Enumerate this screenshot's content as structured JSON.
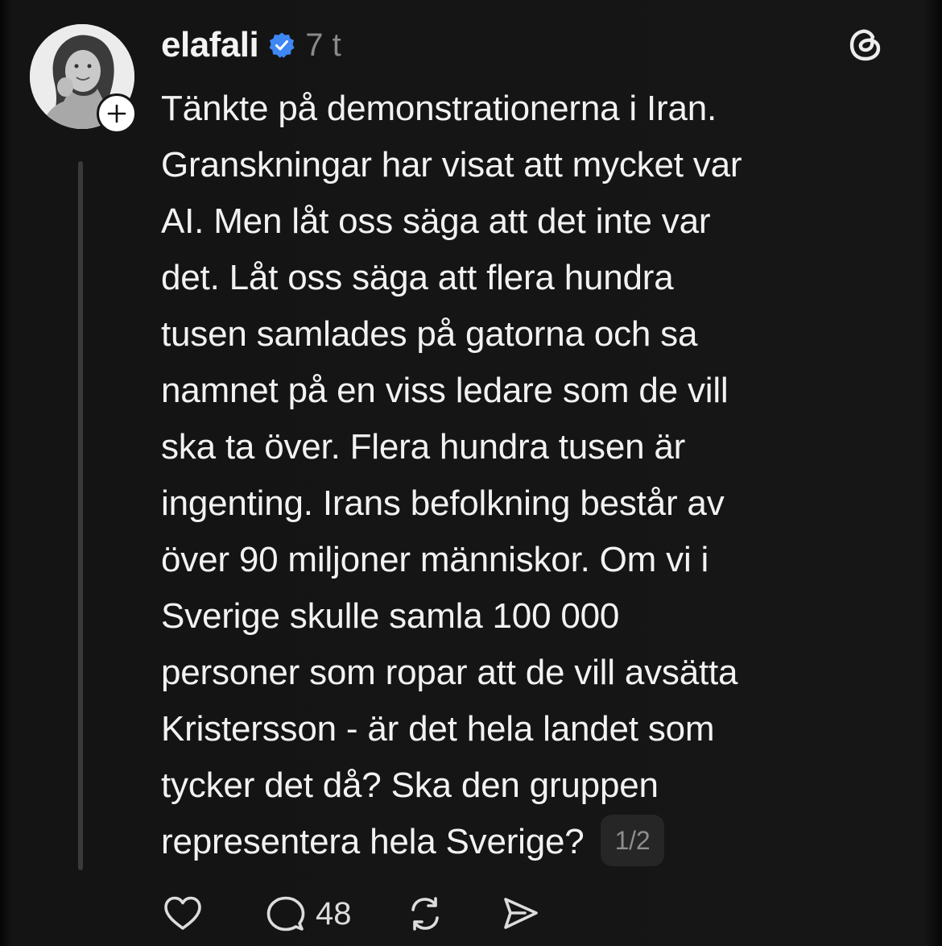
{
  "post": {
    "username": "elafali",
    "timestamp": "7 t",
    "text_lines": [
      "Tänkte på demonstrationerna i Iran.",
      "Granskningar har visat att mycket var",
      "AI. Men låt oss säga att det inte var",
      "det. Låt oss säga att flera hundra",
      "tusen samlades på gatorna och sa",
      "namnet på en viss ledare som de vill",
      "ska ta över. Flera hundra tusen är",
      "ingenting. Irans befolkning består av",
      "över 90 miljoner människor. Om vi i",
      "Sverige skulle samla 100 000",
      "personer som ropar att de vill avsätta",
      "Kristersson - är det hela landet som",
      "tycker det då? Ska den gruppen",
      "representera hela Sverige?"
    ],
    "page_indicator": "1/2"
  },
  "actions": {
    "reply_count": "48"
  },
  "icons": {
    "verified": "verified-badge-icon",
    "threads": "threads-logo-icon",
    "follow": "plus-icon",
    "like": "heart-icon",
    "reply": "comment-icon",
    "repost": "repost-icon",
    "share": "send-icon"
  },
  "colors": {
    "background": "#141414",
    "text": "#f2f2f2",
    "muted": "#8a8a8a",
    "verified_blue": "#3e87f5",
    "thread_line": "#3a3a3a"
  }
}
